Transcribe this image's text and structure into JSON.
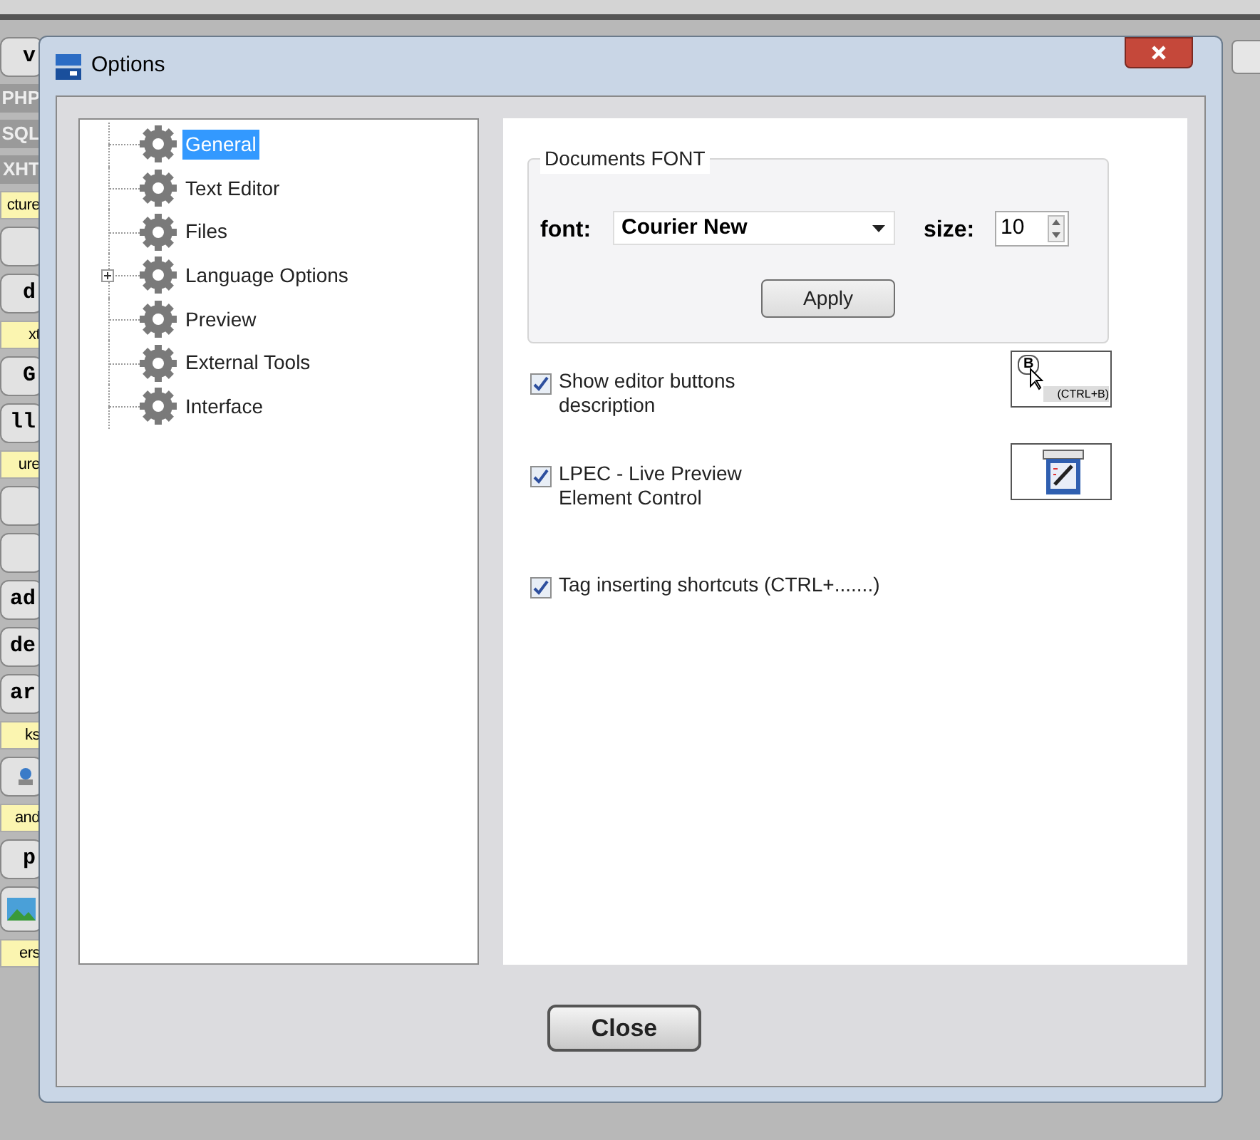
{
  "background_app": {
    "strip_items": [
      {
        "kind": "button",
        "label": "v"
      },
      {
        "kind": "tab",
        "label": "PHP"
      },
      {
        "kind": "tab",
        "label": "SQL"
      },
      {
        "kind": "tab",
        "label": "XHT"
      },
      {
        "kind": "section",
        "label": "cture"
      },
      {
        "kind": "button"
      },
      {
        "kind": "button",
        "label": "d"
      },
      {
        "kind": "section",
        "label": "xt"
      },
      {
        "kind": "button",
        "label": "G"
      },
      {
        "kind": "button",
        "label": "ll"
      },
      {
        "kind": "section",
        "label": "ure"
      },
      {
        "kind": "button"
      },
      {
        "kind": "button"
      },
      {
        "kind": "button",
        "label": "ad"
      },
      {
        "kind": "button",
        "label": "de"
      },
      {
        "kind": "button",
        "label": "ar"
      },
      {
        "kind": "section",
        "label": "ks"
      },
      {
        "kind": "icon"
      },
      {
        "kind": "section",
        "label": "and"
      },
      {
        "kind": "button",
        "label": "p"
      },
      {
        "kind": "image"
      },
      {
        "kind": "section",
        "label": "ers"
      }
    ]
  },
  "dialog": {
    "title": "Options",
    "tree": [
      {
        "label": "General",
        "selected": true,
        "expander": false
      },
      {
        "label": "Text Editor",
        "selected": false,
        "expander": false
      },
      {
        "label": "Files",
        "selected": false,
        "expander": false
      },
      {
        "label": "Language Options",
        "selected": false,
        "expander": true
      },
      {
        "label": "Preview",
        "selected": false,
        "expander": false
      },
      {
        "label": "External Tools",
        "selected": false,
        "expander": false
      },
      {
        "label": "Interface",
        "selected": false,
        "expander": false
      }
    ],
    "font_group": {
      "title": "Documents FONT",
      "font_label": "font:",
      "font_value": "Courier New",
      "size_label": "size:",
      "size_value": "10",
      "apply_button": "Apply"
    },
    "checkboxes": [
      {
        "label": "Show editor buttons description",
        "checked": true,
        "preview": {
          "kind": "tooltip",
          "key": "B",
          "hint": "(CTRL+B)"
        }
      },
      {
        "label": "LPEC - Live Preview Element Control",
        "checked": true,
        "preview": {
          "kind": "window"
        }
      },
      {
        "label": "Tag inserting shortcuts (CTRL+.......)",
        "checked": true
      }
    ],
    "close_button": "Close"
  }
}
